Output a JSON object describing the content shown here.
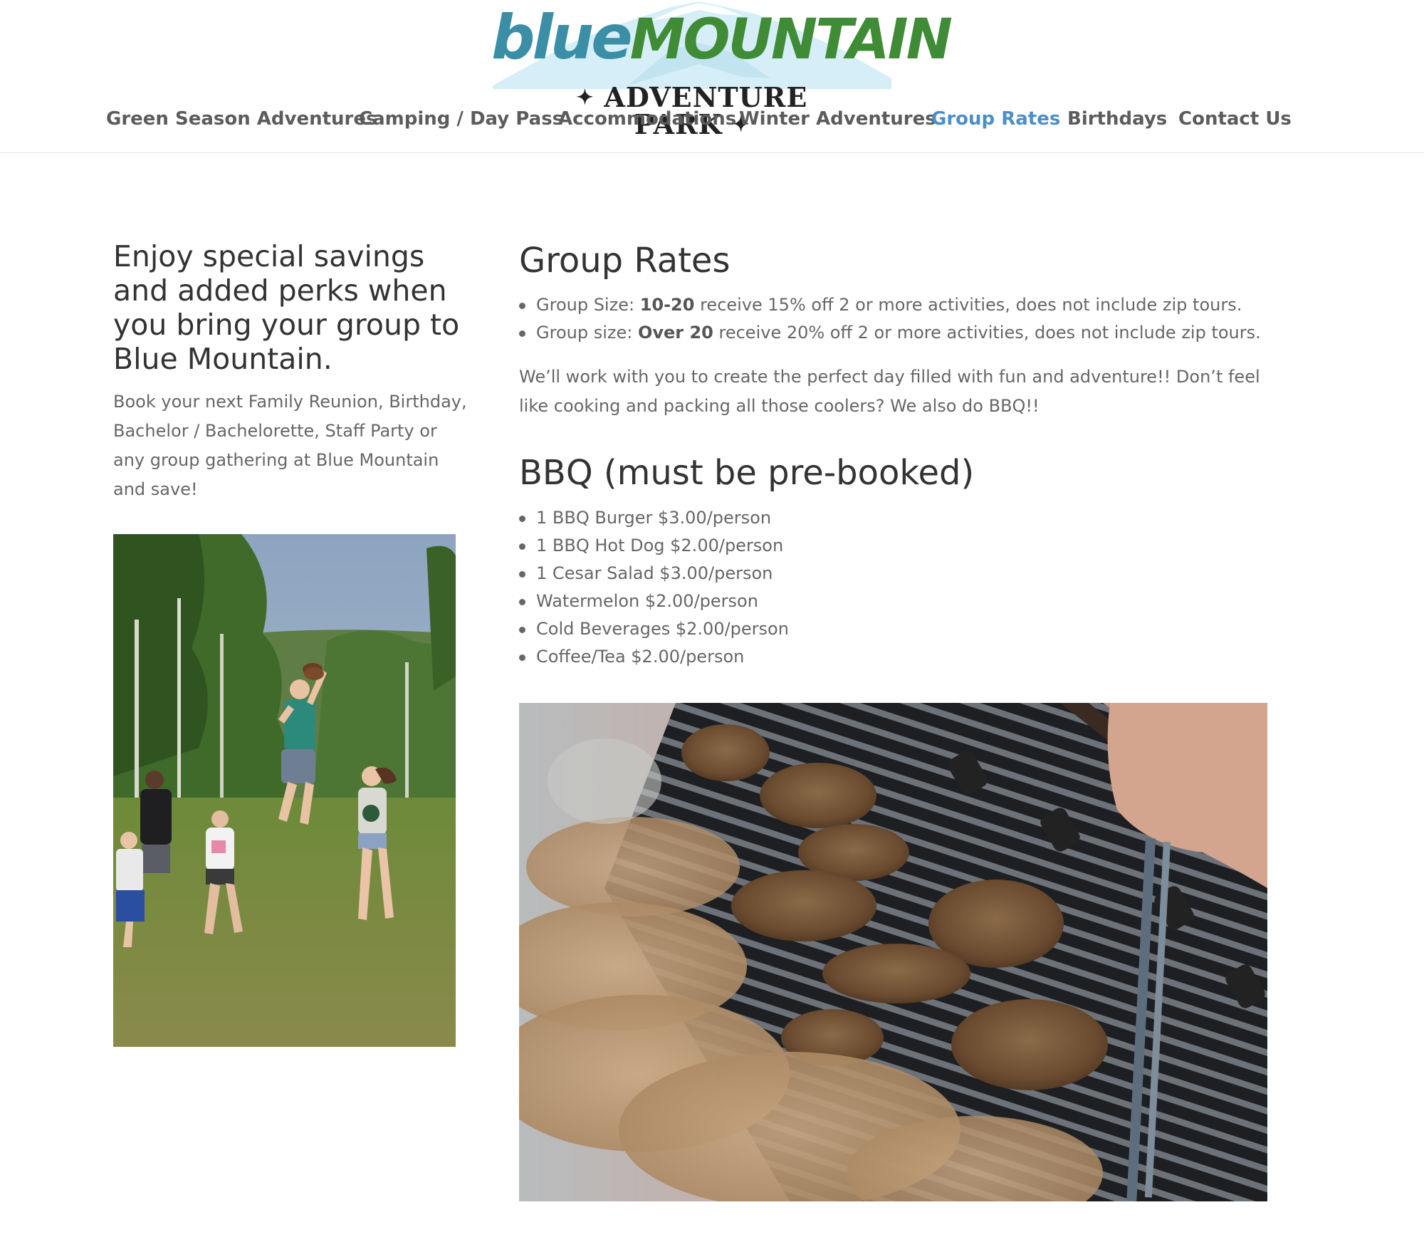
{
  "brand": {
    "logo_word1": "blue",
    "logo_word2": "MOUNTAIN",
    "logo_subtitle": "ADVENTURE PARK"
  },
  "nav": {
    "items": [
      {
        "label": "Green Season Adventures"
      },
      {
        "label": "Camping / Day Pass"
      },
      {
        "label": "Accommodations"
      },
      {
        "label": "Winter Adventures"
      },
      {
        "label": "Group Rates"
      },
      {
        "label": "Birthdays"
      },
      {
        "label": "Contact Us"
      }
    ],
    "active": "Group Rates"
  },
  "intro": {
    "heading": "Enjoy special savings and added perks when you bring your group to Blue Mountain.",
    "text": "Book your next Family Reunion, Birthday, Bachelor / Bachelorette, Staff Party or any group gathering at Blue Mountain and save!"
  },
  "group_rates": {
    "heading": "Group Rates",
    "items": [
      {
        "prefix": "Group Size: ",
        "bold": "10-20",
        "suffix": " receive 15% off 2 or more activities, does not include zip tours."
      },
      {
        "prefix": "Group size: ",
        "bold": "Over 20",
        "suffix": " receive 20% off 2 or more activities, does not include zip tours."
      }
    ],
    "paragraph": "We’ll work with you to create the perfect day filled with fun and adventure!! Don’t feel like cooking and packing all those coolers? We also do BBQ!!"
  },
  "bbq": {
    "heading": "BBQ (must be pre-booked)",
    "items": [
      "1 BBQ Burger $3.00/person",
      "1 BBQ Hot Dog $2.00/person",
      "1 Cesar Salad $3.00/person",
      "Watermelon $2.00/person",
      "Cold Beverages $2.00/person",
      "Coffee/Tea $2.00/person"
    ]
  },
  "colors": {
    "nav_active": "#4c8fc8",
    "nav_text": "#5c5c5c",
    "heading": "#333333",
    "body_text": "#666666",
    "logo_blue": "#3a8ea6",
    "logo_green": "#3f8b36"
  }
}
